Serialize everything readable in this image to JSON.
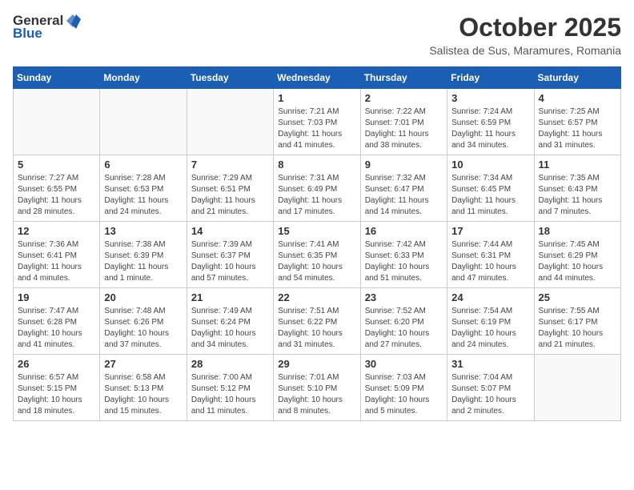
{
  "header": {
    "logo_general": "General",
    "logo_blue": "Blue",
    "month": "October 2025",
    "location": "Salistea de Sus, Maramures, Romania"
  },
  "weekdays": [
    "Sunday",
    "Monday",
    "Tuesday",
    "Wednesday",
    "Thursday",
    "Friday",
    "Saturday"
  ],
  "weeks": [
    [
      {
        "day": "",
        "info": ""
      },
      {
        "day": "",
        "info": ""
      },
      {
        "day": "",
        "info": ""
      },
      {
        "day": "1",
        "info": "Sunrise: 7:21 AM\nSunset: 7:03 PM\nDaylight: 11 hours\nand 41 minutes."
      },
      {
        "day": "2",
        "info": "Sunrise: 7:22 AM\nSunset: 7:01 PM\nDaylight: 11 hours\nand 38 minutes."
      },
      {
        "day": "3",
        "info": "Sunrise: 7:24 AM\nSunset: 6:59 PM\nDaylight: 11 hours\nand 34 minutes."
      },
      {
        "day": "4",
        "info": "Sunrise: 7:25 AM\nSunset: 6:57 PM\nDaylight: 11 hours\nand 31 minutes."
      }
    ],
    [
      {
        "day": "5",
        "info": "Sunrise: 7:27 AM\nSunset: 6:55 PM\nDaylight: 11 hours\nand 28 minutes."
      },
      {
        "day": "6",
        "info": "Sunrise: 7:28 AM\nSunset: 6:53 PM\nDaylight: 11 hours\nand 24 minutes."
      },
      {
        "day": "7",
        "info": "Sunrise: 7:29 AM\nSunset: 6:51 PM\nDaylight: 11 hours\nand 21 minutes."
      },
      {
        "day": "8",
        "info": "Sunrise: 7:31 AM\nSunset: 6:49 PM\nDaylight: 11 hours\nand 17 minutes."
      },
      {
        "day": "9",
        "info": "Sunrise: 7:32 AM\nSunset: 6:47 PM\nDaylight: 11 hours\nand 14 minutes."
      },
      {
        "day": "10",
        "info": "Sunrise: 7:34 AM\nSunset: 6:45 PM\nDaylight: 11 hours\nand 11 minutes."
      },
      {
        "day": "11",
        "info": "Sunrise: 7:35 AM\nSunset: 6:43 PM\nDaylight: 11 hours\nand 7 minutes."
      }
    ],
    [
      {
        "day": "12",
        "info": "Sunrise: 7:36 AM\nSunset: 6:41 PM\nDaylight: 11 hours\nand 4 minutes."
      },
      {
        "day": "13",
        "info": "Sunrise: 7:38 AM\nSunset: 6:39 PM\nDaylight: 11 hours\nand 1 minute."
      },
      {
        "day": "14",
        "info": "Sunrise: 7:39 AM\nSunset: 6:37 PM\nDaylight: 10 hours\nand 57 minutes."
      },
      {
        "day": "15",
        "info": "Sunrise: 7:41 AM\nSunset: 6:35 PM\nDaylight: 10 hours\nand 54 minutes."
      },
      {
        "day": "16",
        "info": "Sunrise: 7:42 AM\nSunset: 6:33 PM\nDaylight: 10 hours\nand 51 minutes."
      },
      {
        "day": "17",
        "info": "Sunrise: 7:44 AM\nSunset: 6:31 PM\nDaylight: 10 hours\nand 47 minutes."
      },
      {
        "day": "18",
        "info": "Sunrise: 7:45 AM\nSunset: 6:29 PM\nDaylight: 10 hours\nand 44 minutes."
      }
    ],
    [
      {
        "day": "19",
        "info": "Sunrise: 7:47 AM\nSunset: 6:28 PM\nDaylight: 10 hours\nand 41 minutes."
      },
      {
        "day": "20",
        "info": "Sunrise: 7:48 AM\nSunset: 6:26 PM\nDaylight: 10 hours\nand 37 minutes."
      },
      {
        "day": "21",
        "info": "Sunrise: 7:49 AM\nSunset: 6:24 PM\nDaylight: 10 hours\nand 34 minutes."
      },
      {
        "day": "22",
        "info": "Sunrise: 7:51 AM\nSunset: 6:22 PM\nDaylight: 10 hours\nand 31 minutes."
      },
      {
        "day": "23",
        "info": "Sunrise: 7:52 AM\nSunset: 6:20 PM\nDaylight: 10 hours\nand 27 minutes."
      },
      {
        "day": "24",
        "info": "Sunrise: 7:54 AM\nSunset: 6:19 PM\nDaylight: 10 hours\nand 24 minutes."
      },
      {
        "day": "25",
        "info": "Sunrise: 7:55 AM\nSunset: 6:17 PM\nDaylight: 10 hours\nand 21 minutes."
      }
    ],
    [
      {
        "day": "26",
        "info": "Sunrise: 6:57 AM\nSunset: 5:15 PM\nDaylight: 10 hours\nand 18 minutes."
      },
      {
        "day": "27",
        "info": "Sunrise: 6:58 AM\nSunset: 5:13 PM\nDaylight: 10 hours\nand 15 minutes."
      },
      {
        "day": "28",
        "info": "Sunrise: 7:00 AM\nSunset: 5:12 PM\nDaylight: 10 hours\nand 11 minutes."
      },
      {
        "day": "29",
        "info": "Sunrise: 7:01 AM\nSunset: 5:10 PM\nDaylight: 10 hours\nand 8 minutes."
      },
      {
        "day": "30",
        "info": "Sunrise: 7:03 AM\nSunset: 5:09 PM\nDaylight: 10 hours\nand 5 minutes."
      },
      {
        "day": "31",
        "info": "Sunrise: 7:04 AM\nSunset: 5:07 PM\nDaylight: 10 hours\nand 2 minutes."
      },
      {
        "day": "",
        "info": ""
      }
    ]
  ]
}
